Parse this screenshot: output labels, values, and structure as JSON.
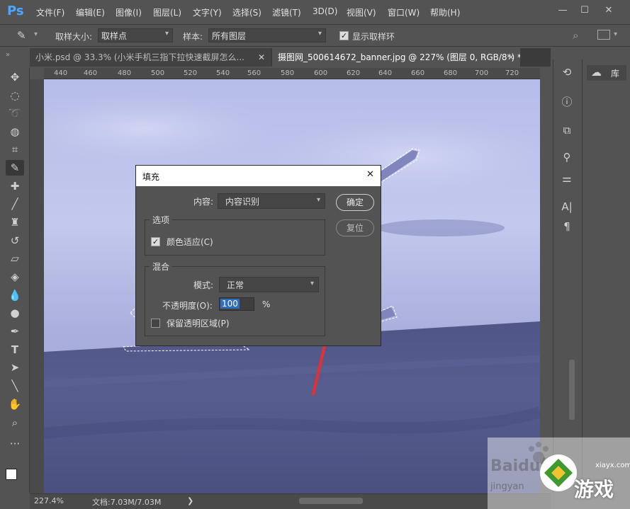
{
  "app": {
    "logo": "Ps"
  },
  "menu": [
    "文件(F)",
    "编辑(E)",
    "图像(I)",
    "图层(L)",
    "文字(Y)",
    "选择(S)",
    "滤镜(T)",
    "3D(D)",
    "视图(V)",
    "窗口(W)",
    "帮助(H)"
  ],
  "window_controls": {
    "minimize": "—",
    "maximize": "☐",
    "close": "✕"
  },
  "options": {
    "sample_size_label": "取样大小:",
    "sample_size_value": "取样点",
    "sample_label": "样本:",
    "sample_value": "所有图层",
    "show_ring_label": "显示取样环",
    "show_ring_checked": true
  },
  "tabs": [
    {
      "label": "小米.psd @ 33.3% (小米手机三指下拉快速截屏怎么...",
      "close": "✕",
      "active": false
    },
    {
      "label": "摄图网_500614672_banner.jpg @ 227% (图层 0, RGB/8*) *",
      "close": "✕",
      "active": true
    }
  ],
  "ruler_ticks": [
    "440",
    "460",
    "480",
    "500",
    "520",
    "540",
    "560",
    "580",
    "600",
    "620",
    "640",
    "660",
    "680",
    "700",
    "720"
  ],
  "status": {
    "zoom": "227.4%",
    "doc": "文档:7.03M/7.03M",
    "arrow": "❯"
  },
  "panel_library_label": "库",
  "dialog": {
    "title": "填充",
    "close": "✕",
    "content_label": "内容:",
    "content_value": "内容识别",
    "options_group": "选项",
    "color_adapt_label": "颜色适应(C)",
    "color_adapt_checked": true,
    "blend_group": "混合",
    "mode_label": "模式:",
    "mode_value": "正常",
    "opacity_label": "不透明度(O):",
    "opacity_value": "100",
    "opacity_unit": "%",
    "preserve_label": "保留透明区域(P)",
    "preserve_checked": false,
    "ok_label": "确定",
    "reset_label": "复位"
  },
  "watermark": {
    "brand": "Baidu经验",
    "site": "jingyan",
    "logo_text": "游戏",
    "domain": "xiayx.com"
  },
  "colors": {
    "accent": "#4aa6ff",
    "arrow": "#e63030",
    "ui_bg": "#535353"
  }
}
